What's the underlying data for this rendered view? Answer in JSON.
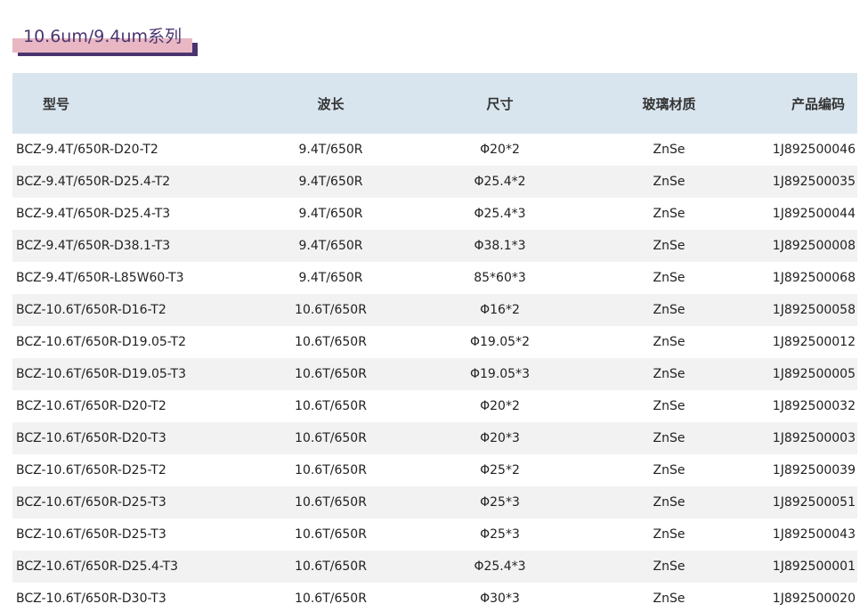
{
  "section": {
    "title": "10.6um/9.4um系列"
  },
  "table": {
    "headers": [
      "型号",
      "波长",
      "尺寸",
      "玻璃材质",
      "产品编码"
    ],
    "rows": [
      [
        "BCZ-9.4T/650R-D20-T2",
        "9.4T/650R",
        "Φ20*2",
        "ZnSe",
        "1J892500046"
      ],
      [
        "BCZ-9.4T/650R-D25.4-T2",
        "9.4T/650R",
        "Φ25.4*2",
        "ZnSe",
        "1J892500035"
      ],
      [
        "BCZ-9.4T/650R-D25.4-T3",
        "9.4T/650R",
        "Φ25.4*3",
        "ZnSe",
        "1J892500044"
      ],
      [
        "BCZ-9.4T/650R-D38.1-T3",
        "9.4T/650R",
        "Φ38.1*3",
        "ZnSe",
        "1J892500008"
      ],
      [
        "BCZ-9.4T/650R-L85W60-T3",
        "9.4T/650R",
        "85*60*3",
        "ZnSe",
        "1J892500068"
      ],
      [
        "BCZ-10.6T/650R-D16-T2",
        "10.6T/650R",
        "Φ16*2",
        "ZnSe",
        "1J892500058"
      ],
      [
        "BCZ-10.6T/650R-D19.05-T2",
        "10.6T/650R",
        "Φ19.05*2",
        "ZnSe",
        "1J892500012"
      ],
      [
        "BCZ-10.6T/650R-D19.05-T3",
        "10.6T/650R",
        "Φ19.05*3",
        "ZnSe",
        "1J892500005"
      ],
      [
        "BCZ-10.6T/650R-D20-T2",
        "10.6T/650R",
        "Φ20*2",
        "ZnSe",
        "1J892500032"
      ],
      [
        "BCZ-10.6T/650R-D20-T3",
        "10.6T/650R",
        "Φ20*3",
        "ZnSe",
        "1J892500003"
      ],
      [
        "BCZ-10.6T/650R-D25-T2",
        "10.6T/650R",
        "Φ25*2",
        "ZnSe",
        "1J892500039"
      ],
      [
        "BCZ-10.6T/650R-D25-T3",
        "10.6T/650R",
        "Φ25*3",
        "ZnSe",
        "1J892500051"
      ],
      [
        "BCZ-10.6T/650R-D25-T3",
        "10.6T/650R",
        "Φ25*3",
        "ZnSe",
        "1J892500043"
      ],
      [
        "BCZ-10.6T/650R-D25.4-T3",
        "10.6T/650R",
        "Φ25.4*3",
        "ZnSe",
        "1J892500001"
      ],
      [
        "BCZ-10.6T/650R-D30-T3",
        "10.6T/650R",
        "Φ30*3",
        "ZnSe",
        "1J892500020"
      ]
    ]
  },
  "colors": {
    "title_text": "#4a3470",
    "title_highlight": "#e8b7c3",
    "header_bg": "#d9e5ee",
    "row_alt_bg": "#f2f2f2"
  }
}
